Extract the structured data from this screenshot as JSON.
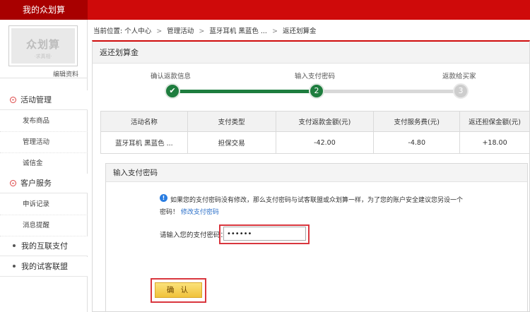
{
  "header": {
    "title": "我的众划算"
  },
  "sidebar": {
    "logo_main": "众划算",
    "logo_sub": "·求真相·",
    "edit_profile": "编辑资料",
    "groups": [
      {
        "label": "活动管理",
        "items": [
          "发布商品",
          "管理活动",
          "诚信金"
        ]
      },
      {
        "label": "客户服务",
        "items": [
          "申诉记录",
          "消息提醒"
        ]
      },
      {
        "label": "我的互联支付"
      },
      {
        "label": "我的试客联盟"
      }
    ]
  },
  "breadcrumb": {
    "prefix": "当前位置:",
    "items": [
      "个人中心",
      "管理活动",
      "蓝牙耳机 黑蓝色 ...",
      "返还划算金"
    ],
    "separator": ">"
  },
  "panel": {
    "title": "返还划算金"
  },
  "steps": [
    {
      "label": "确认返款信息",
      "marker": "✔",
      "status": "done"
    },
    {
      "label": "输入支付密码",
      "marker": "2",
      "status": "current"
    },
    {
      "label": "返款给买家",
      "marker": "3",
      "status": "todo"
    }
  ],
  "table": {
    "headers": [
      "活动名称",
      "支付类型",
      "支付返款金额(元)",
      "支付服务费(元)",
      "返还担保金额(元)"
    ],
    "rows": [
      [
        "蓝牙耳机 黑蓝色 ...",
        "担保交易",
        "-42.00",
        "-4.80",
        "+18.00"
      ]
    ]
  },
  "password": {
    "title": "输入支付密码",
    "info_line1": "如果您的支付密码没有修改，那么支付密码与试客联盟或众划算一样，为了您的账户安全建议您另设一个",
    "info_line2_prefix": "密码！",
    "info_link": "修改支付密码",
    "label": "请输入您的支付密码：",
    "value": "••••••",
    "confirm_label": "确 认"
  },
  "colors": {
    "brand_red": "#cf0a0a",
    "step_green": "#1e7d3e",
    "negative": "#d33333",
    "positive": "#229944",
    "highlight": "#d9363e"
  }
}
